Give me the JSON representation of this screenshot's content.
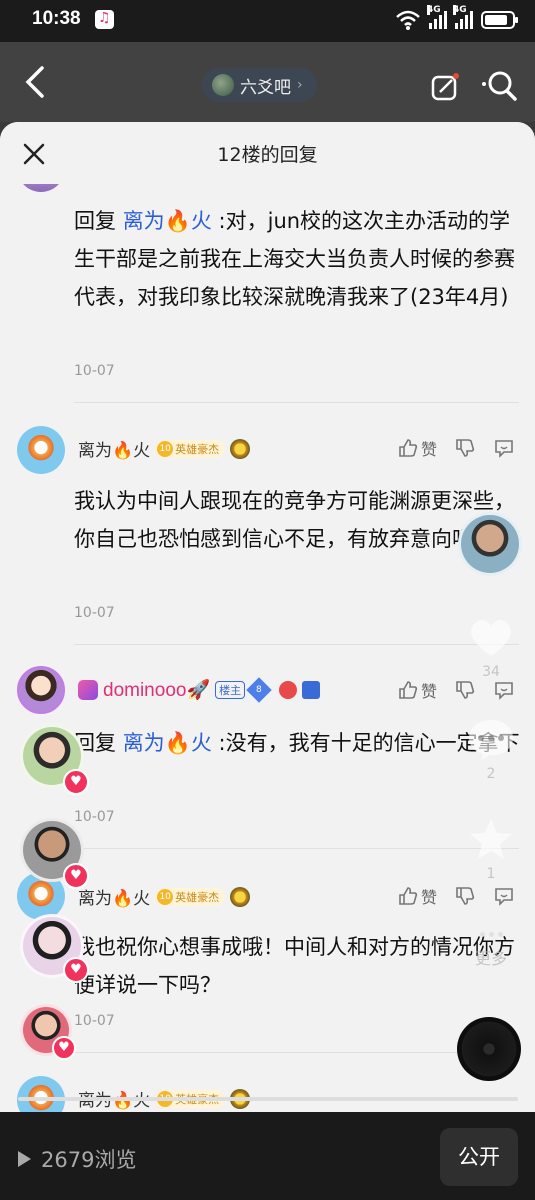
{
  "status_bar": {
    "time": "10:38",
    "net1": "4G",
    "net2": "4G"
  },
  "header": {
    "forum_name": "六爻吧"
  },
  "sheet": {
    "title": "12楼的回复"
  },
  "replies": [
    {
      "reply_prefix": "回复",
      "reply_to": "离为🔥火",
      "text": ":对，jun校的这次主办活动的学生干部是之前我在上海交大当负责人时候的参赛代表，对我印象比较深就晚清我来了(23年4月)",
      "date": "10-07"
    },
    {
      "username": "离为🔥火",
      "badge_level": "10",
      "badge_label": "英雄豪杰",
      "like_label": "赞",
      "text": "我认为中间人跟现在的竞争方可能渊源更深些，你自己也恐怕感到信心不足，有放弃意向吧",
      "date": "10-07"
    },
    {
      "username": "dominooo🚀",
      "op_tag": "楼主",
      "level": "8",
      "like_label": "赞",
      "reply_prefix": "回复",
      "reply_to": "离为🔥火",
      "text": ":没有，我有十足的信心一定拿下",
      "date": "10-07"
    },
    {
      "username": "离为🔥火",
      "badge_level": "10",
      "badge_label": "英雄豪杰",
      "like_label": "赞",
      "text": "我也祝你心想事成哦！中间人和对方的情况你方便详说一下吗？",
      "date": "10-07"
    },
    {
      "username": "离为🔥火",
      "badge_level": "10",
      "badge_label": "英雄豪杰"
    }
  ],
  "side": {
    "likes": "34",
    "comments": "2",
    "favorites": "1",
    "more": "更多"
  },
  "bottom": {
    "views": "2679浏览",
    "public_label": "公开"
  }
}
